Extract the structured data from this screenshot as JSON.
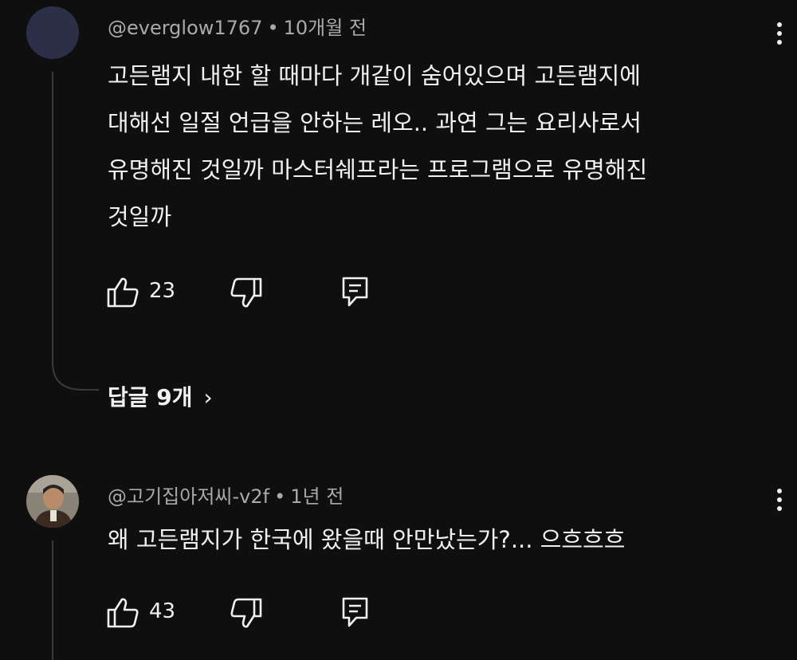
{
  "comments": [
    {
      "author": "@everglow1767",
      "time": "10개월 전",
      "lines": [
        "고든램지 내한 할 때마다 개같이 숨어있으며 고든램지에",
        "대해선 일절 언급을 안하는 레오.. 과연 그는 요리사로서",
        "유명해진 것일까 마스터쉐프라는 프로그램으로 유명해진",
        "것일까"
      ],
      "likes": "23",
      "replies_label": "답글 9개",
      "avatar_color": "#2b3048"
    },
    {
      "author": "@고기집아저씨-v2f",
      "time": "1년 전",
      "lines": [
        "왜 고든램지가 한국에 왔을때 안만났는가?... 으흐흐흐"
      ],
      "likes": "43"
    }
  ],
  "icons": {
    "like": "thumbs-up-icon",
    "dislike": "thumbs-down-icon",
    "reply": "reply-icon",
    "more": "more-vertical-icon",
    "chevron": "chevron-right-icon"
  },
  "separator": "•",
  "chevron_glyph": "›"
}
